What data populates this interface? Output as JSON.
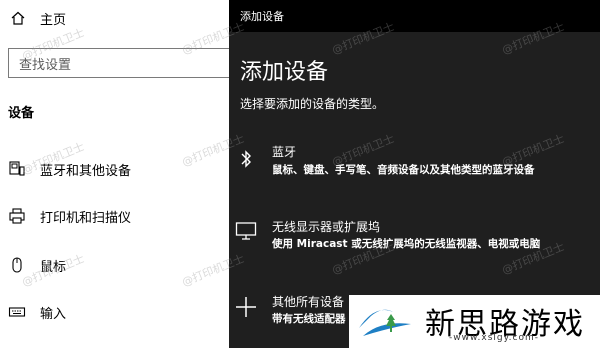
{
  "settings": {
    "home_label": "主页",
    "search_placeholder": "查找设置",
    "section_title": "设备",
    "nav": [
      {
        "label": "蓝牙和其他设备",
        "icon": "bluetooth-devices-icon"
      },
      {
        "label": "打印机和扫描仪",
        "icon": "printer-icon"
      },
      {
        "label": "鼠标",
        "icon": "mouse-icon"
      },
      {
        "label": "输入",
        "icon": "keyboard-icon"
      }
    ]
  },
  "dialog": {
    "window_title": "添加设备",
    "heading": "添加设备",
    "subtitle": "选择要添加的设备的类型。",
    "options": [
      {
        "title": "蓝牙",
        "desc": "鼠标、键盘、手写笔、音频设备以及其他类型的蓝牙设备",
        "icon": "bluetooth-icon"
      },
      {
        "title": "无线显示器或扩展坞",
        "desc": "使用 Miracast 或无线扩展坞的无线监视器、电视或电脑",
        "icon": "monitor-icon"
      },
      {
        "title": "其他所有设备",
        "desc": "带有无线适配器",
        "icon": "plus-icon"
      }
    ]
  },
  "watermark": "@打印机卫士",
  "logo": {
    "name": "新思路游戏",
    "url": "-www.xslgy.com-"
  },
  "colors": {
    "dialog_bg": "#1f1f1f",
    "titlebar_bg": "#000000",
    "logo_blue": "#1e7fc4",
    "logo_green": "#3a9a4a"
  }
}
